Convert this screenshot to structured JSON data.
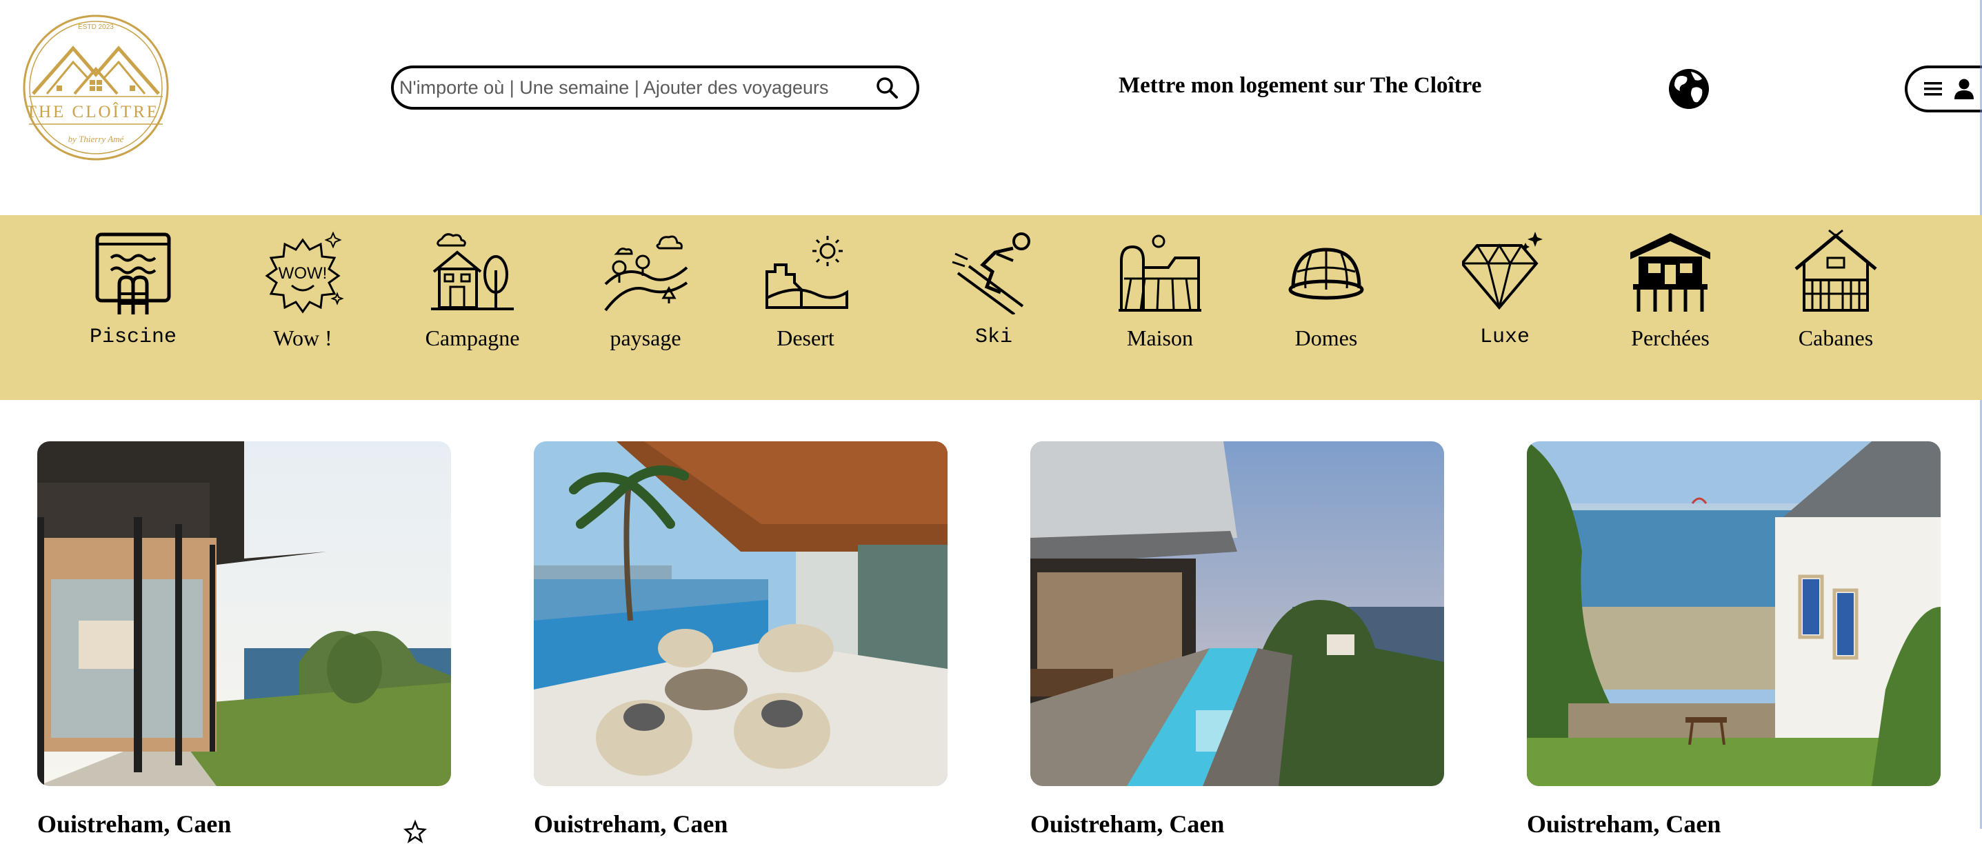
{
  "brand": {
    "estd": "ESTD 2023",
    "name": "THE CLOÎTRE,",
    "signature": "by Thierry Amé"
  },
  "search": {
    "placeholder": "N'importe où | Une semaine | Ajouter des voyageurs",
    "icon": "search-icon"
  },
  "header": {
    "host_link": "Mettre mon logement sur The Cloître",
    "globe_icon": "globe-icon",
    "menu_icon": "hamburger-icon",
    "user_icon": "user-icon"
  },
  "categories": [
    {
      "label": "Piscine",
      "icon": "pool-icon"
    },
    {
      "label": "Wow !",
      "icon": "wow-icon"
    },
    {
      "label": "Campagne",
      "icon": "countryside-house-icon"
    },
    {
      "label": "paysage",
      "icon": "landscape-icon"
    },
    {
      "label": "Desert",
      "icon": "desert-icon"
    },
    {
      "label": "Ski",
      "icon": "ski-icon"
    },
    {
      "label": "Maison",
      "icon": "farm-house-icon"
    },
    {
      "label": "Domes",
      "icon": "dome-icon"
    },
    {
      "label": "Luxe",
      "icon": "diamond-icon"
    },
    {
      "label": "Perchées",
      "icon": "stilt-house-icon"
    },
    {
      "label": "Cabanes",
      "icon": "cabin-icon"
    }
  ],
  "listings": [
    {
      "title": "Ouistreham, Caen",
      "photo": "glass-villa-sea-view"
    },
    {
      "title": "Ouistreham, Caen",
      "photo": "palm-terrace-infinity-pool"
    },
    {
      "title": "Ouistreham, Caen",
      "photo": "modern-villa-lap-pool"
    },
    {
      "title": "Ouistreham, Caen",
      "photo": "breton-cottage-seaside"
    }
  ],
  "colors": {
    "category_bar": "#e8d58d",
    "logo_gold": "#c9a24a"
  }
}
